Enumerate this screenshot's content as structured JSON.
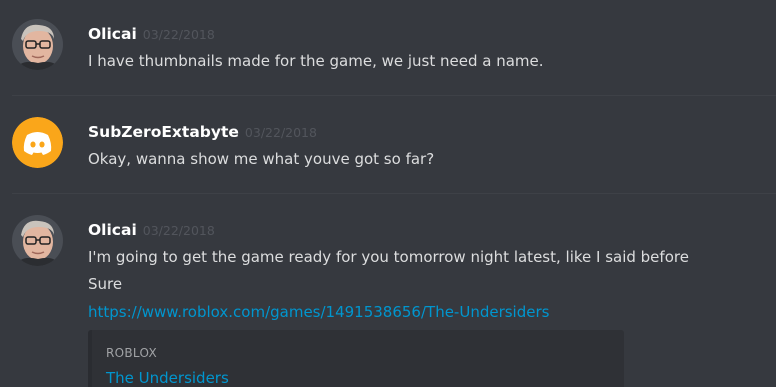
{
  "messages": [
    {
      "author": "Olicai",
      "timestamp": "03/22/2018",
      "avatar_icon": "person-avatar-icon",
      "lines": [
        "I have thumbnails made for the game, we just need a name."
      ]
    },
    {
      "author": "SubZeroExtabyte",
      "timestamp": "03/22/2018",
      "avatar_icon": "discord-logo-icon",
      "lines": [
        "Okay, wanna show me what youve got so far?"
      ]
    },
    {
      "author": "Olicai",
      "timestamp": "03/22/2018",
      "avatar_icon": "person-avatar-icon",
      "lines": [
        "I'm going to get the game ready for you tomorrow night latest, like I said before",
        "Sure"
      ],
      "link": "https://www.roblox.com/games/1491538656/The-Undersiders",
      "embed": {
        "provider": "ROBLOX",
        "title": "The Undersiders"
      }
    }
  ],
  "colors": {
    "background": "#36393f",
    "username": "#ffffff",
    "timestamp": "#52555c",
    "message_text": "#dcddde",
    "link": "#0096cf",
    "embed_background": "#2f3136",
    "discord_avatar_bg": "#faa61a"
  }
}
